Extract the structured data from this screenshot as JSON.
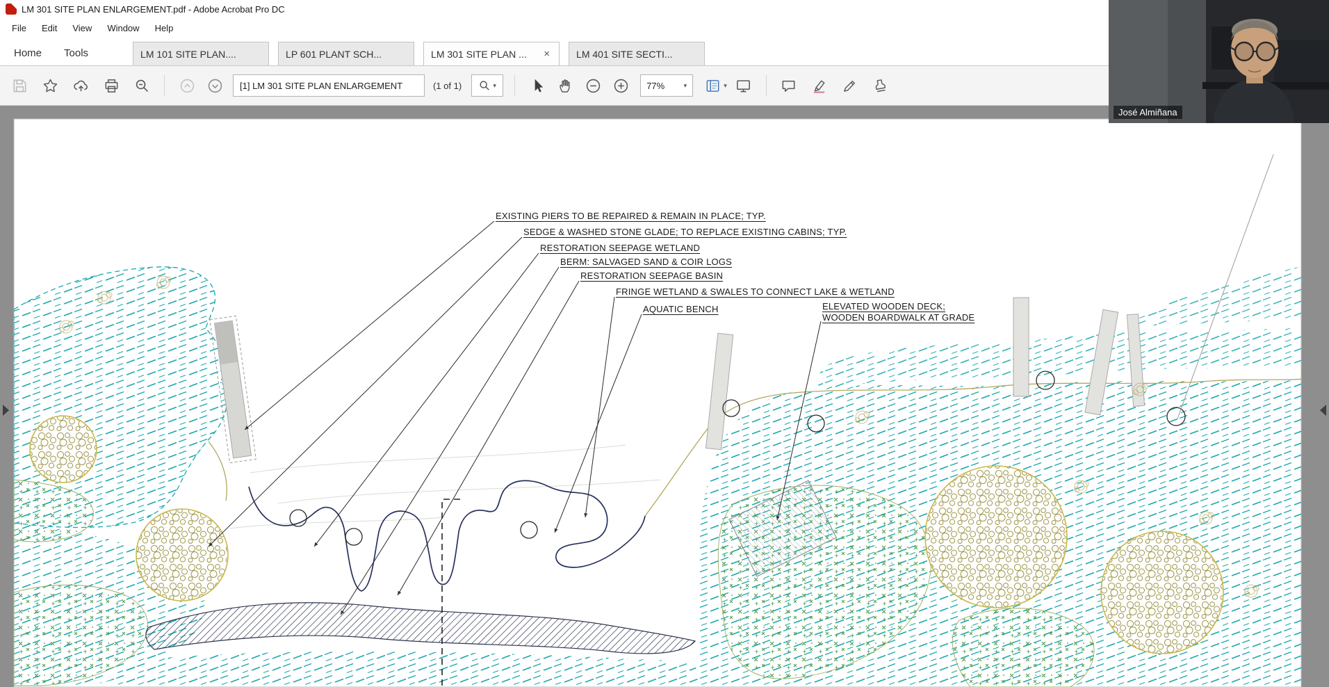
{
  "window": {
    "title": "LM 301 SITE PLAN ENLARGEMENT.pdf - Adobe Acrobat Pro DC"
  },
  "menubar": {
    "items": [
      "File",
      "Edit",
      "View",
      "Window",
      "Help"
    ]
  },
  "tabbar": {
    "home": "Home",
    "tools": "Tools",
    "close_glyph": "×",
    "doc_tabs": [
      {
        "label": "LM 101 SITE PLAN....",
        "active": false
      },
      {
        "label": "LP 601 PLANT SCH...",
        "active": false
      },
      {
        "label": "LM 301 SITE PLAN ...",
        "active": true
      },
      {
        "label": "LM 401 SITE SECTI...",
        "active": false
      }
    ]
  },
  "toolbar": {
    "page_input": "[1] LM 301 SITE PLAN ENLARGEMENT",
    "page_count": "(1 of 1)",
    "zoom_value": "77%",
    "zoom_caret": "▾"
  },
  "video": {
    "participant_name": "José Almiñana"
  },
  "annotations": [
    "EXISTING PIERS TO BE REPAIRED & REMAIN IN PLACE; TYP.",
    "SEDGE & WASHED STONE GLADE; TO REPLACE EXISTING CABINS; TYP.",
    "RESTORATION SEEPAGE WETLAND",
    "BERM: SALVAGED SAND & COIR LOGS",
    "RESTORATION SEEPAGE BASIN",
    "FRINGE WETLAND & SWALES TO CONNECT LAKE & WETLAND",
    "AQUATIC BENCH",
    "ELEVATED WOODEN DECK;",
    "WOODEN BOARDWALK AT GRADE"
  ],
  "colors": {
    "wetland_teal": "#1ba8ae",
    "planting_green": "#4f9a45",
    "contour_olive": "#b3a75f",
    "hatch_navy": "#30364f",
    "toolbar_icon_gray": "#5a5a5a"
  }
}
